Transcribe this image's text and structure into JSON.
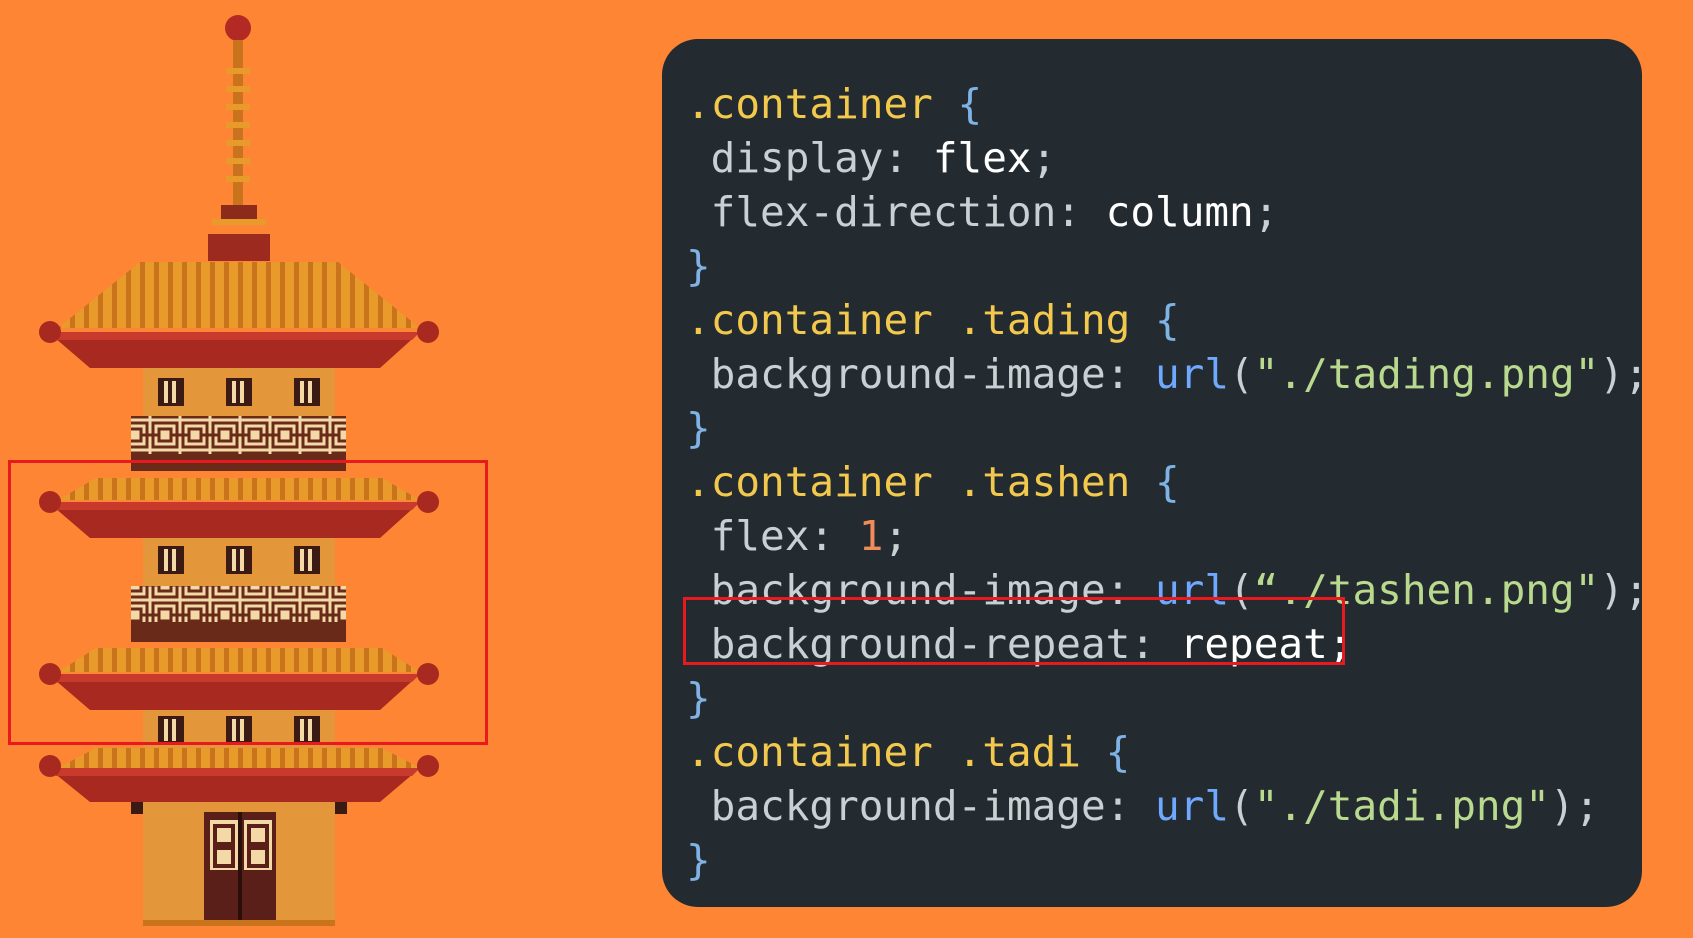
{
  "colors": {
    "background": "#fd8533",
    "panel": "#242b30",
    "highlight": "#e8191f"
  },
  "code": {
    "l1": {
      "sel": ".container ",
      "brace": "{"
    },
    "l2": {
      "prop": " display: ",
      "val": "flex",
      "semi": ";"
    },
    "l3": {
      "prop": " flex-direction: ",
      "val": "column",
      "semi": ";"
    },
    "l4": {
      "brace": "}"
    },
    "l5": {
      "sel": ".container .tading ",
      "brace": "{"
    },
    "l6": {
      "prop": " background-image: ",
      "func": "url",
      "open": "(",
      "str": "\"./tading.png\"",
      "close": ");"
    },
    "l7": {
      "brace": "}"
    },
    "l8": {
      "sel": ".container .tashen ",
      "brace": "{"
    },
    "l9": {
      "prop": " flex: ",
      "num": "1",
      "semi": ";"
    },
    "l10": {
      "prop": " background-image: ",
      "func": "url",
      "open": "(",
      "str": "“./tashen.png\"",
      "close": ");"
    },
    "l11": {
      "prop": " background-repeat: ",
      "val": "repeat",
      "semi": ";"
    },
    "l12": {
      "brace": "}"
    },
    "l13": {
      "sel": ".container .tadi ",
      "brace": "{"
    },
    "l14": {
      "prop": " background-image: ",
      "func": "url",
      "open": "(",
      "str": "\"./tadi.png\"",
      "close": ");"
    },
    "l15": {
      "brace": "}"
    }
  }
}
